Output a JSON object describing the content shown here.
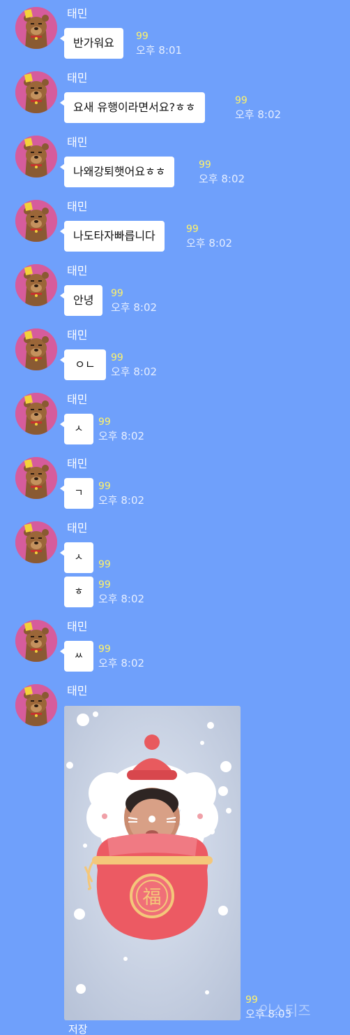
{
  "sender": "태민",
  "unread": "99",
  "messages": [
    {
      "text": "반가워요",
      "time": "오후 8:01"
    },
    {
      "text": "요새 유행이라면서요?ㅎㅎ",
      "time": "오후 8:02"
    },
    {
      "text": "나왜강퇴햇어요ㅎㅎ",
      "time": "오후 8:02"
    },
    {
      "text": "나도타자빠릅니다",
      "time": "오후 8:02"
    },
    {
      "text": "안녕",
      "time": "오후 8:02"
    },
    {
      "text": "ㅇㄴ",
      "time": "오후 8:02"
    },
    {
      "text": "ㅅ",
      "time": "오후 8:02"
    },
    {
      "text": "ㄱ",
      "time": "오후 8:02"
    },
    {
      "text": "ㅅ"
    },
    {
      "text": "ㅎ",
      "time": "오후 8:02"
    },
    {
      "text": "ㅆ",
      "time": "오후 8:02"
    }
  ],
  "photo": {
    "stamp": "福",
    "time": "오후 8:03",
    "save_label": "저장"
  },
  "watermark": "인스티즈",
  "colors": {
    "background": "#6fa0fb",
    "avatar": "#d65c9c",
    "unread": "#fff36a"
  },
  "icons": {
    "avatar": "bear-character-icon"
  }
}
